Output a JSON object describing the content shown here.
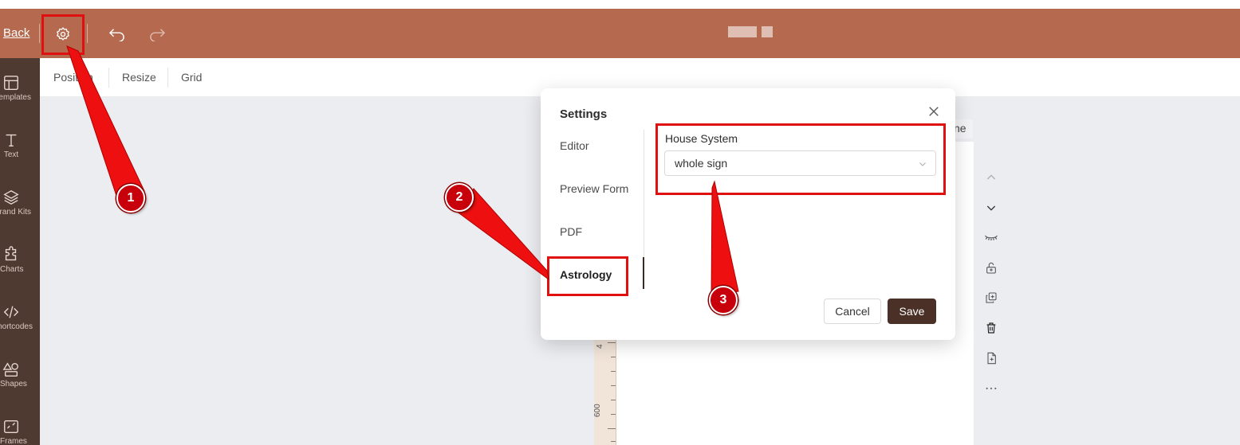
{
  "header": {
    "back_label": "Back",
    "settings_icon": "gear-icon",
    "undo_icon": "undo-icon",
    "redo_icon": "redo-icon",
    "bg_color": "#b5694e"
  },
  "sidebar": {
    "items": [
      {
        "label": "Templates",
        "icon": "layout-icon"
      },
      {
        "label": "Text",
        "icon": "text-icon"
      },
      {
        "label": "Brand Kits",
        "icon": "layers-icon"
      },
      {
        "label": "Charts",
        "icon": "puzzle-icon"
      },
      {
        "label": "Shortcodes",
        "icon": "code-icon"
      },
      {
        "label": "Shapes",
        "icon": "shapes-icon"
      },
      {
        "label": "Frames",
        "icon": "frame-icon"
      }
    ]
  },
  "toolbar": {
    "position_label": "Position",
    "resize_label": "Resize",
    "grid_label": "Grid"
  },
  "canvas": {
    "ruler_labels": [
      "600",
      "4"
    ],
    "peek_label": "ne"
  },
  "settings_modal": {
    "title": "Settings",
    "nav": [
      {
        "label": "Editor"
      },
      {
        "label": "Preview Form"
      },
      {
        "label": "PDF"
      },
      {
        "label": "Astrology"
      }
    ],
    "active_tab": "Astrology",
    "house_system_label": "House System",
    "house_system_value": "whole sign",
    "cancel_label": "Cancel",
    "save_label": "Save"
  },
  "annotations": {
    "markers": [
      "1",
      "2",
      "3"
    ],
    "color": "#e01010"
  }
}
